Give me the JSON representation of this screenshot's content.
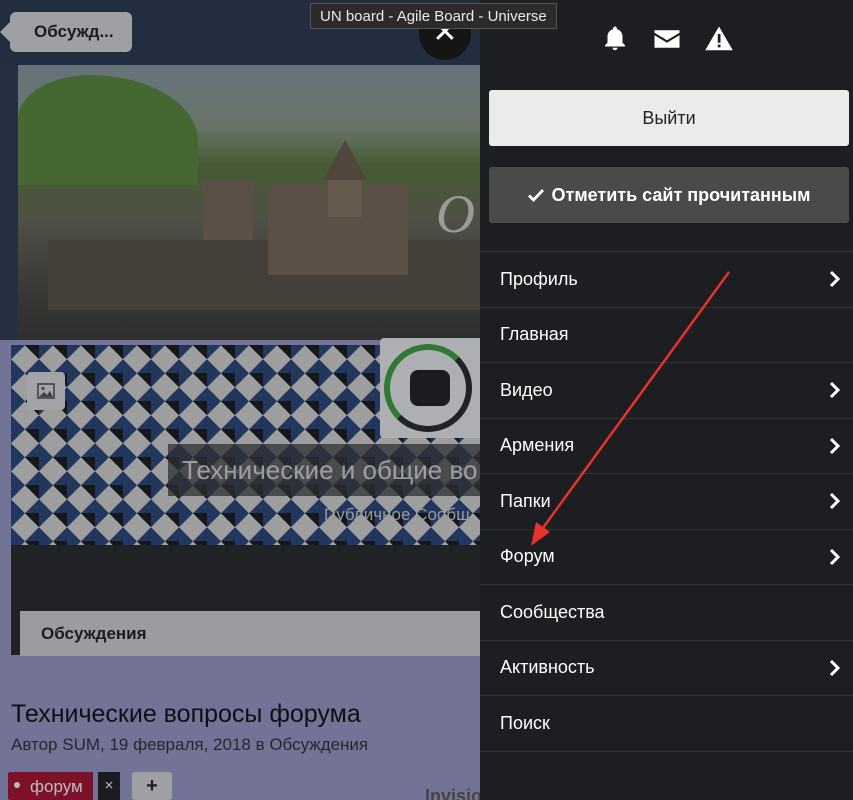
{
  "window": {
    "tooltip": "UN board - Agile Board - Universe"
  },
  "background_page": {
    "breadcrumb": "Обсужд...",
    "hero_letter": "O",
    "club": {
      "title": "Технические и общие во",
      "subtitle": "Публичное Сообщ",
      "tab": "Обсуждения"
    },
    "topic": {
      "title": "Технические вопросы форума",
      "meta": "Автор SUM, 19 февраля, 2018 в Обсуждения",
      "tag": "форум",
      "tag_remove": "×",
      "tag_add": "+"
    },
    "footer_text": "Invision Community"
  },
  "drawer": {
    "close_glyph": "✕",
    "icons": [
      "bell-icon",
      "envelope-icon",
      "warning-icon"
    ],
    "logout_label": "Выйти",
    "mark_read_label": "Отметить сайт прочитанным",
    "menu": [
      {
        "label": "Профиль",
        "has_submenu": true
      },
      {
        "label": "Главная",
        "has_submenu": false
      },
      {
        "label": "Видео",
        "has_submenu": true
      },
      {
        "label": "Армения",
        "has_submenu": true
      },
      {
        "label": "Папки",
        "has_submenu": true
      },
      {
        "label": "Форум",
        "has_submenu": true
      },
      {
        "label": "Сообщества",
        "has_submenu": false
      },
      {
        "label": "Активность",
        "has_submenu": true
      },
      {
        "label": "Поиск",
        "has_submenu": false
      }
    ]
  },
  "annotation": {
    "arrow_color": "#e8322c",
    "points_to": "Форум"
  }
}
